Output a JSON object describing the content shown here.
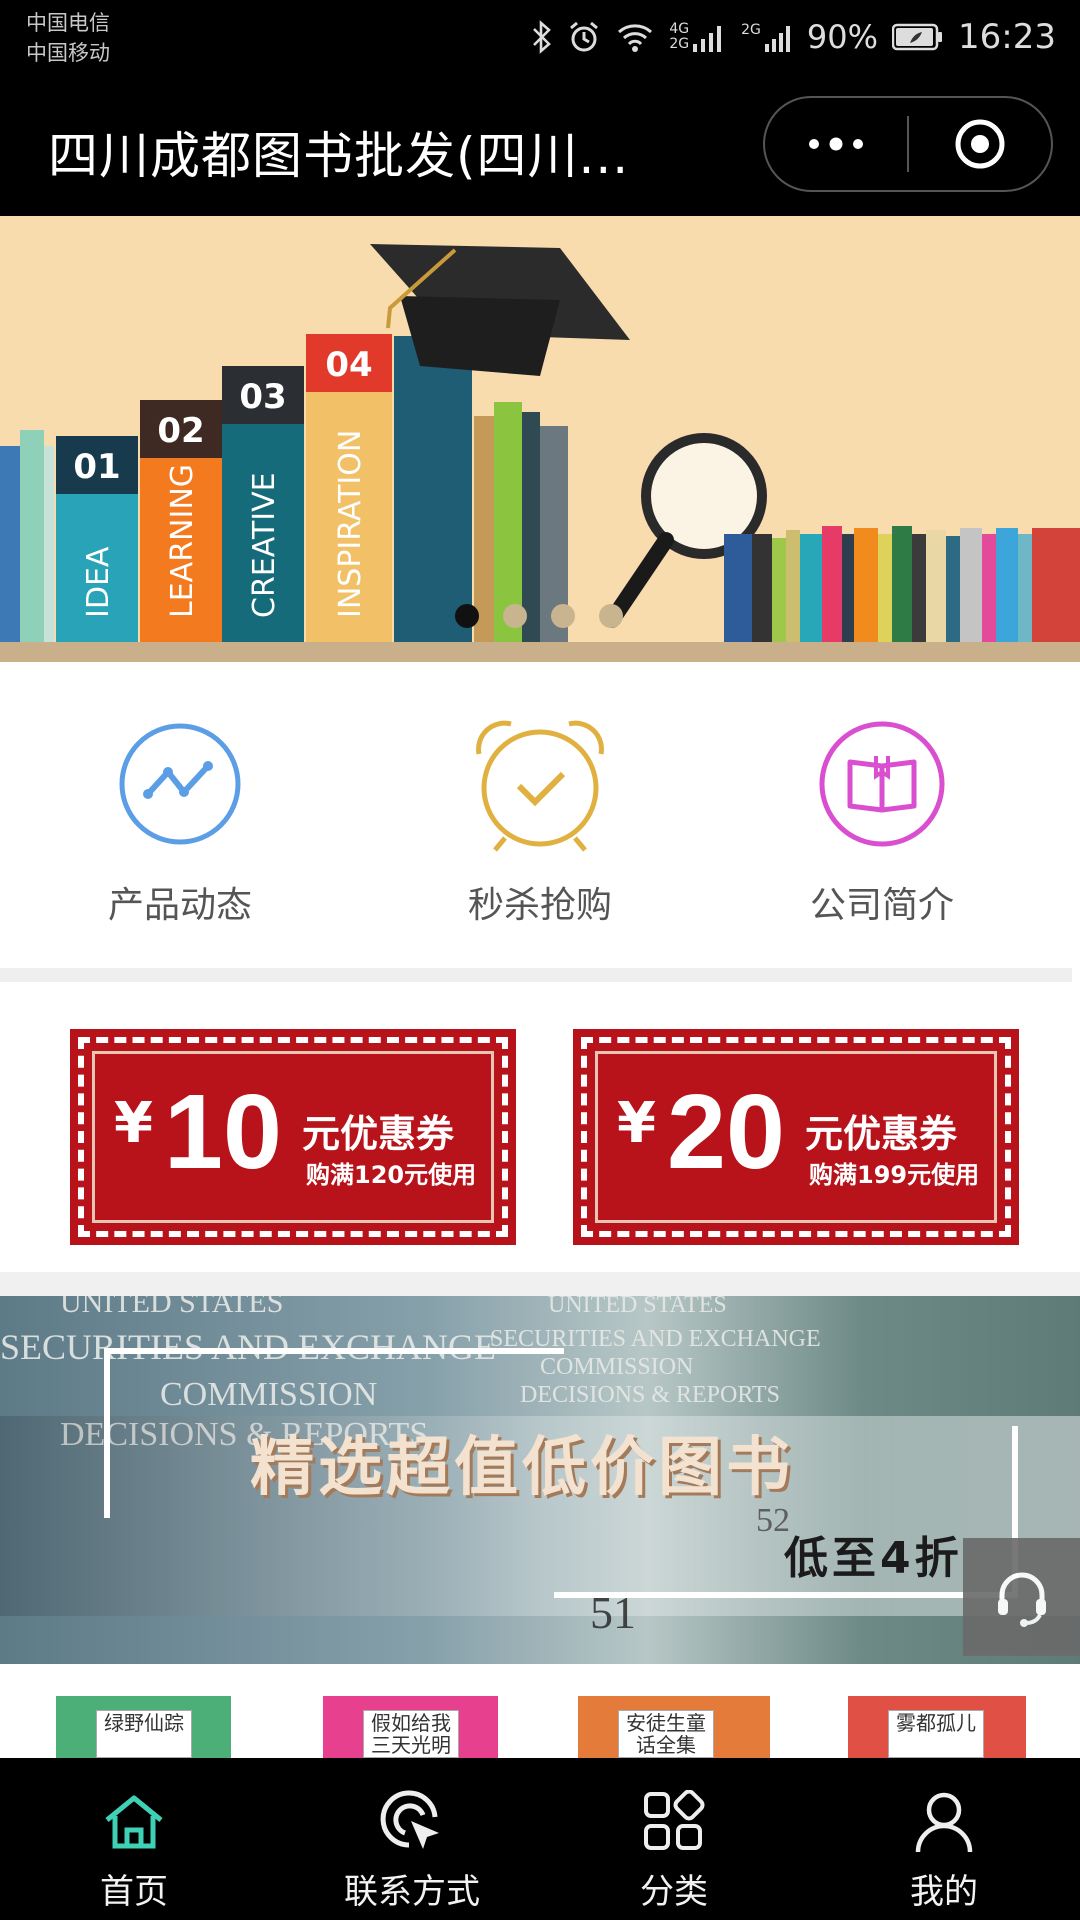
{
  "status_bar": {
    "carrier_1": "中国电信",
    "carrier_2": "中国移动",
    "net_4g": "4G",
    "net_2g": "2G",
    "net_2g_b": "2G",
    "battery": "90%",
    "time": "16:23"
  },
  "title_bar": {
    "title": "四川成都图书批发(四川..."
  },
  "banner": {
    "slides_count": 4,
    "active_index": 0,
    "book_labels": [
      "01",
      "IDEA",
      "02",
      "LEARNING",
      "03",
      "CREATIVE",
      "04",
      "INSPIRATION"
    ]
  },
  "nav": {
    "items": [
      {
        "label": "产品动态",
        "icon": "trend-chart-icon",
        "color": "#5b9ee6"
      },
      {
        "label": "秒杀抢购",
        "icon": "alarm-clock-icon",
        "color": "#e0b040"
      },
      {
        "label": "公司简介",
        "icon": "open-book-icon",
        "color": "#d94fd0"
      }
    ]
  },
  "coupons": [
    {
      "currency": "¥",
      "amount": "10",
      "kind": "元优惠券",
      "condition": "购满120元使用"
    },
    {
      "currency": "¥",
      "amount": "20",
      "kind": "元优惠券",
      "condition": "购满199元使用"
    }
  ],
  "promo": {
    "headline": "精选超值低价图书",
    "sub": "低至4折",
    "bg_text_1": "UNITED STATES",
    "bg_text_2": "SECURITIES AND EXCHANGE",
    "bg_text_3": "COMMISSION",
    "bg_text_4": "DECISIONS & REPORTS",
    "bg_num_1": "51",
    "bg_num_2": "52"
  },
  "products": [
    {
      "title": "绿野仙踪",
      "color": "#4caf78"
    },
    {
      "title": "假如给我三天光明",
      "color": "#e6408e"
    },
    {
      "title": "安徒生童话全集",
      "color": "#e57b3a"
    },
    {
      "title": "雾都孤儿",
      "color": "#e05045"
    }
  ],
  "tabbar": {
    "tabs": [
      {
        "label": "首页",
        "icon": "home-icon",
        "active": true,
        "color": "#3fd1b6"
      },
      {
        "label": "联系方式",
        "icon": "cursor-click-icon",
        "active": false
      },
      {
        "label": "分类",
        "icon": "category-grid-icon",
        "active": false
      },
      {
        "label": "我的",
        "icon": "user-icon",
        "active": false
      }
    ]
  }
}
